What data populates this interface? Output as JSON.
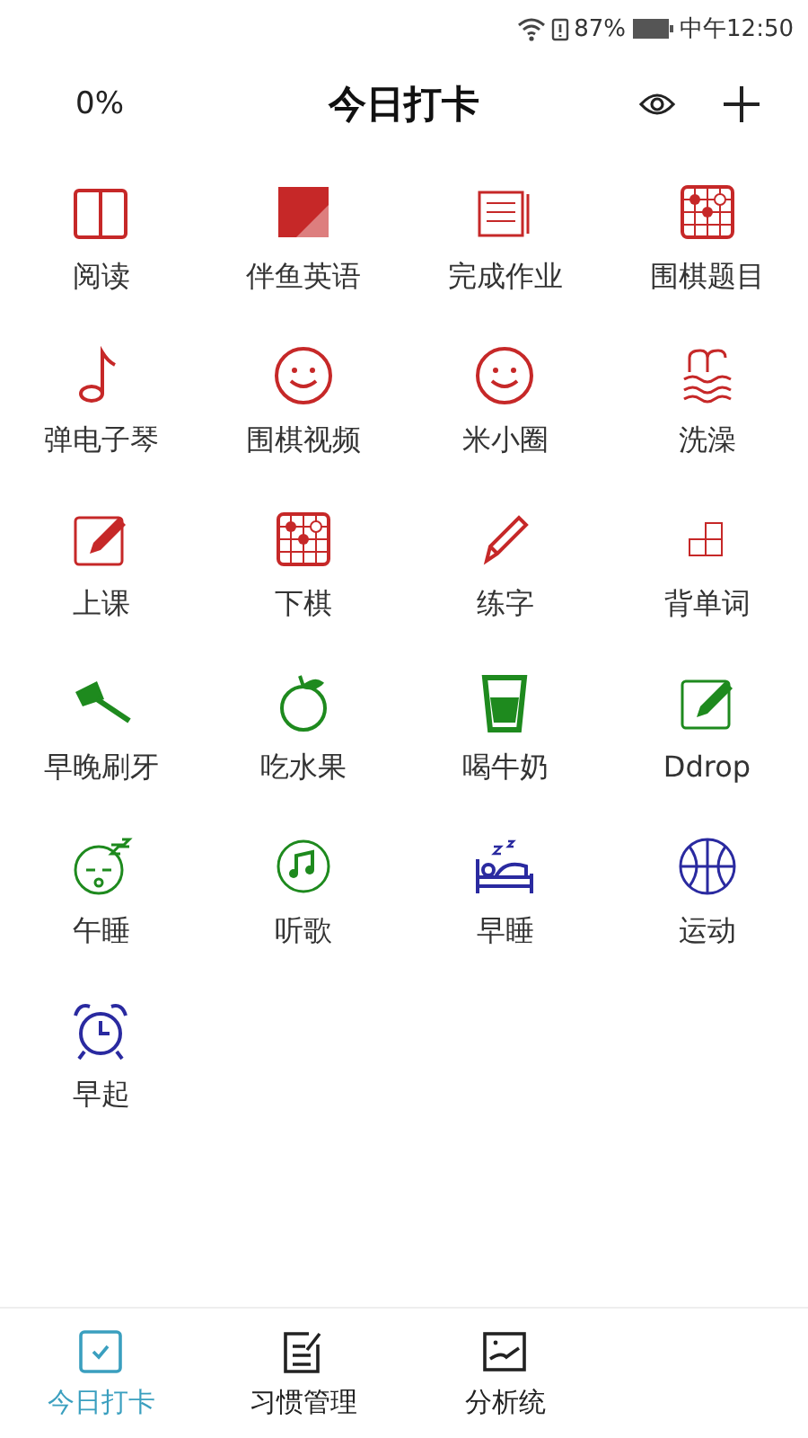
{
  "status_bar": {
    "battery": "87%",
    "time": "中午12:50"
  },
  "header": {
    "progress": "0%",
    "title": "今日打卡"
  },
  "habits": [
    {
      "label": "阅读",
      "kind": "book",
      "color": "#c62828"
    },
    {
      "label": "伴鱼英语",
      "kind": "en",
      "color": "#c62828"
    },
    {
      "label": "完成作业",
      "kind": "notebook",
      "color": "#c62828"
    },
    {
      "label": "围棋题目",
      "kind": "board",
      "color": "#c62828"
    },
    {
      "label": "弹电子琴",
      "kind": "note",
      "color": "#c62828"
    },
    {
      "label": "围棋视频",
      "kind": "smile",
      "color": "#c62828"
    },
    {
      "label": "米小圈",
      "kind": "smile",
      "color": "#c62828"
    },
    {
      "label": "洗澡",
      "kind": "swim",
      "color": "#c62828"
    },
    {
      "label": "上课",
      "kind": "edit",
      "color": "#c62828"
    },
    {
      "label": "下棋",
      "kind": "board",
      "color": "#c62828"
    },
    {
      "label": "练字",
      "kind": "pencil",
      "color": "#c62828"
    },
    {
      "label": "背单词",
      "kind": "blocks",
      "color": "#c62828"
    },
    {
      "label": "早晚刷牙",
      "kind": "toothbrush",
      "color": "#1e8a1e"
    },
    {
      "label": "吃水果",
      "kind": "fruit",
      "color": "#1e8a1e"
    },
    {
      "label": "喝牛奶",
      "kind": "cup",
      "color": "#1e8a1e"
    },
    {
      "label": "Ddrop",
      "kind": "edit",
      "color": "#1e8a1e"
    },
    {
      "label": "午睡",
      "kind": "sleepy",
      "color": "#1e8a1e"
    },
    {
      "label": "听歌",
      "kind": "music",
      "color": "#1e8a1e"
    },
    {
      "label": "早睡",
      "kind": "bed",
      "color": "#2a2aa0"
    },
    {
      "label": "运动",
      "kind": "ball",
      "color": "#2a2aa0"
    },
    {
      "label": "早起",
      "kind": "alarm",
      "color": "#2a2aa0"
    }
  ],
  "tabs": [
    {
      "label": "今日打卡",
      "kind": "check",
      "selected": true
    },
    {
      "label": "习惯管理",
      "kind": "list",
      "selected": false
    },
    {
      "label": "分析统",
      "kind": "chart",
      "selected": false
    }
  ]
}
